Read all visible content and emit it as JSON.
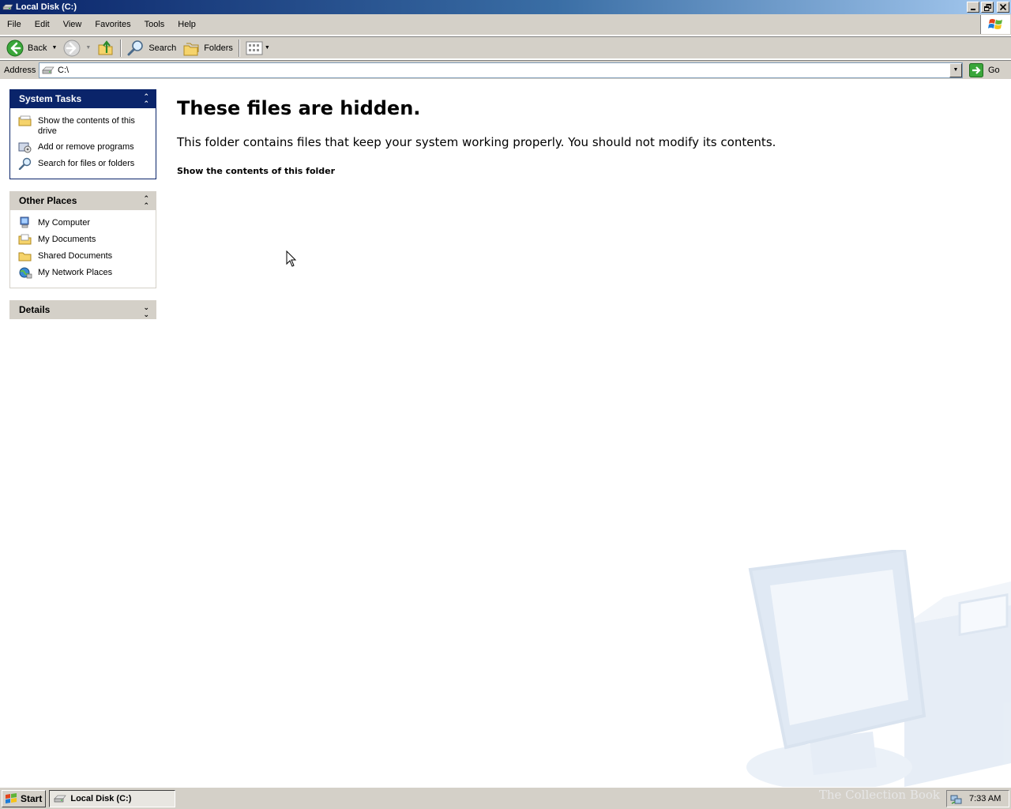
{
  "window": {
    "title": "Local Disk (C:)",
    "buttons": {
      "minimize": "minimize",
      "restore": "restore",
      "close": "close"
    }
  },
  "menu": [
    "File",
    "Edit",
    "View",
    "Favorites",
    "Tools",
    "Help"
  ],
  "toolbar": {
    "back_label": "Back",
    "search_label": "Search",
    "folders_label": "Folders"
  },
  "address": {
    "label": "Address",
    "value": "C:\\",
    "go_label": "Go"
  },
  "task_pane": {
    "system_tasks": {
      "title": "System Tasks",
      "items": [
        "Show the contents of this drive",
        "Add or remove programs",
        "Search for files or folders"
      ]
    },
    "other_places": {
      "title": "Other Places",
      "items": [
        "My Computer",
        "My Documents",
        "Shared Documents",
        "My Network Places"
      ]
    },
    "details": {
      "title": "Details"
    }
  },
  "content": {
    "heading": "These files are hidden.",
    "message": "This folder contains files that keep your system working properly. You should not modify its contents.",
    "link": "Show the contents of this folder"
  },
  "taskbar": {
    "start_label": "Start",
    "active_window": "Local Disk (C:)",
    "clock": "7:33 AM",
    "watermark": "The Collection Book"
  },
  "colors": {
    "title_gradient_start": "#0a246a",
    "panel_header_blue": "#0a246a",
    "chrome_gray": "#d4d0c8"
  }
}
